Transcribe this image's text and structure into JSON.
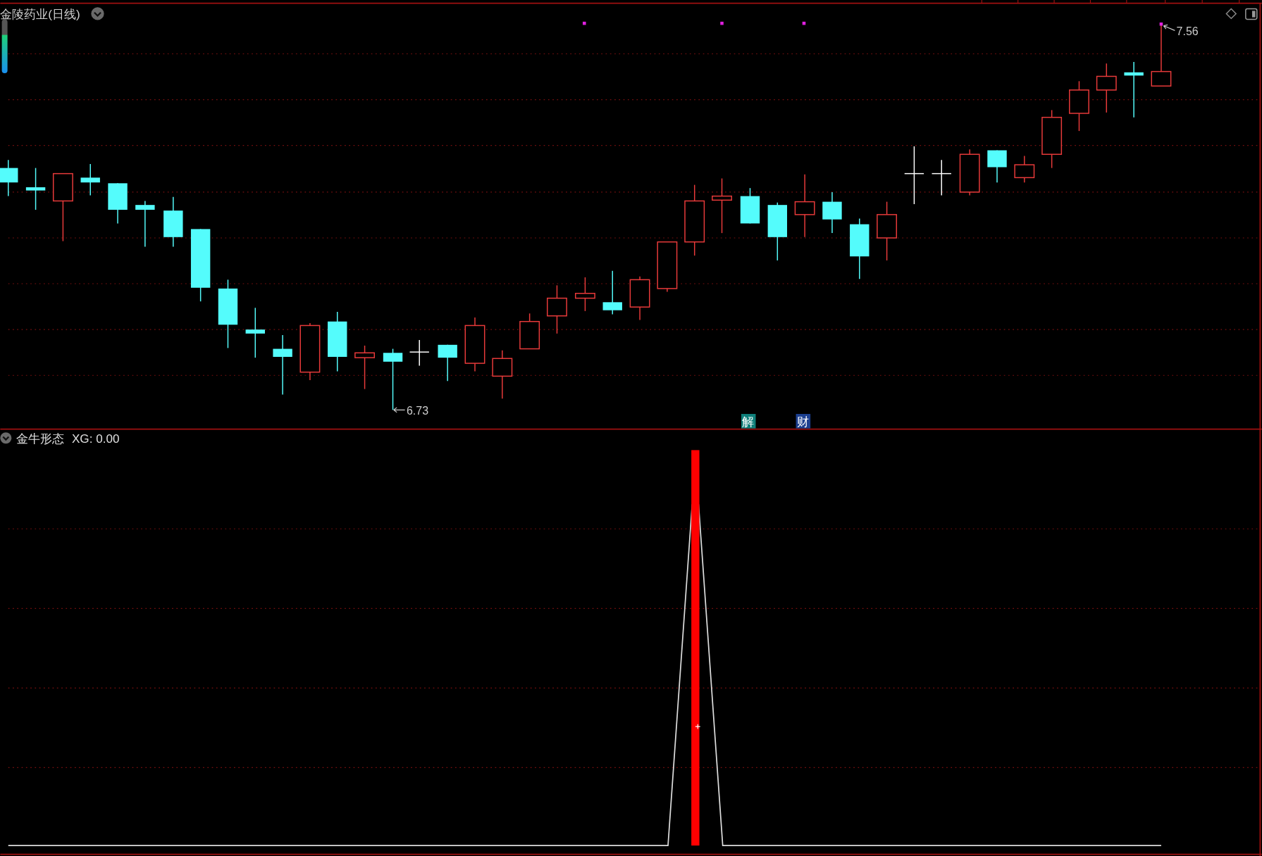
{
  "main_panel": {
    "title": "金陵药业(日线)",
    "high_label": "7.56",
    "low_label": "6.73",
    "event_badges": [
      {
        "text": "解",
        "color": "#0f7f7a"
      },
      {
        "text": "财",
        "color": "#1c3f8f"
      }
    ]
  },
  "indicator_panel": {
    "title": "金牛形态",
    "value": "XG: 0.00"
  }
}
